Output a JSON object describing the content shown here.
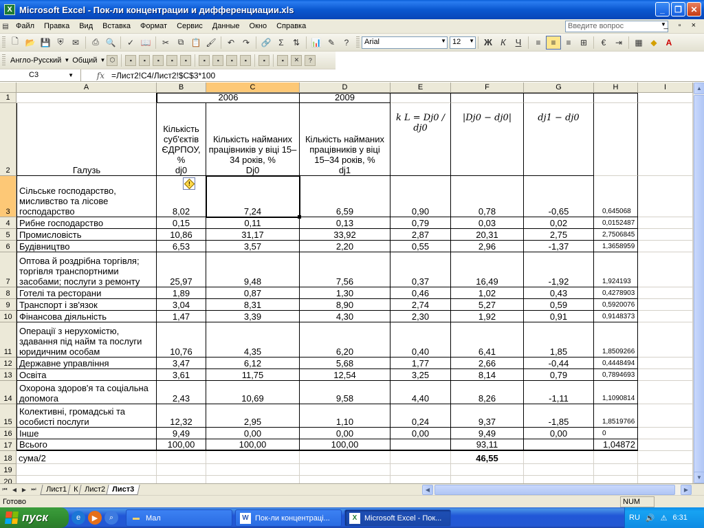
{
  "window": {
    "title": "Microsoft Excel - Пок-ли концентрации и дифференциации.xls",
    "app_icon": "X",
    "controls": [
      "minimize",
      "maximize",
      "close"
    ]
  },
  "menu": {
    "items": [
      "Файл",
      "Правка",
      "Вид",
      "Вставка",
      "Формат",
      "Сервис",
      "Данные",
      "Окно",
      "Справка"
    ],
    "ask_placeholder": "Введите вопрос",
    "mdi_controls": "_ ▫ ×"
  },
  "toolbar": {
    "font_name": "Arial",
    "font_size": "12",
    "bold": "Ж",
    "italic": "К",
    "underline": "Ч",
    "sigma": "Σ",
    "language": "Англо-Русский",
    "general": "Общий"
  },
  "formula_bar": {
    "name_box": "C3",
    "fx": "fx",
    "formula": "=Лист2!C4/Лист2!$C$3*100"
  },
  "columns": [
    "A",
    "B",
    "C",
    "D",
    "E",
    "F",
    "G",
    "H",
    "I"
  ],
  "selected_column": "C",
  "selected_row": "3",
  "header_rows": {
    "year_2006": "2006",
    "year_2009": "2009",
    "a2": "Галузь",
    "b2": "Кількість суб'єктів ЄДРПОУ, %\ndj0",
    "c2": "Кількість найманих працівників у віці 15–34 років, %\nDj0",
    "d2": "Кількість найманих працівників у віці 15–34 років, %\ndj1",
    "e2": "k L = Dj0 / dj0",
    "f2": "|Dj0 − dj0|",
    "g2": "dj1 − dj0"
  },
  "rows": [
    {
      "n": "3",
      "a": "Сільське господарство, мисливство та лісове господарство",
      "b": "8,02",
      "c": "7,24",
      "d": "6,59",
      "e": "0,90",
      "f": "0,78",
      "g": "-0,65",
      "h": "0,645068"
    },
    {
      "n": "4",
      "a": "Рибне господарство",
      "b": "0,15",
      "c": "0,11",
      "d": "0,13",
      "e": "0,79",
      "f": "0,03",
      "g": "0,02",
      "h": "0,0152487"
    },
    {
      "n": "5",
      "a": "Промисловість",
      "b": "10,86",
      "c": "31,17",
      "d": "33,92",
      "e": "2,87",
      "f": "20,31",
      "g": "2,75",
      "h": "2,7506845"
    },
    {
      "n": "6",
      "a": "Будівництво",
      "b": "6,53",
      "c": "3,57",
      "d": "2,20",
      "e": "0,55",
      "f": "2,96",
      "g": "-1,37",
      "h": "1,3658959"
    },
    {
      "n": "7",
      "a": "Оптова й роздрібна торгівля; торгівля транспортними засобами; послуги з ремонту",
      "b": "25,97",
      "c": "9,48",
      "d": "7,56",
      "e": "0,37",
      "f": "16,49",
      "g": "-1,92",
      "h": "1,924193"
    },
    {
      "n": "8",
      "a": "Готелі та ресторани",
      "b": "1,89",
      "c": "0,87",
      "d": "1,30",
      "e": "0,46",
      "f": "1,02",
      "g": "0,43",
      "h": "0,4278903"
    },
    {
      "n": "9",
      "a": "Транспорт і зв'язок",
      "b": "3,04",
      "c": "8,31",
      "d": "8,90",
      "e": "2,74",
      "f": "5,27",
      "g": "0,59",
      "h": "0,5920076"
    },
    {
      "n": "10",
      "a": "Фінансова діяльність",
      "b": "1,47",
      "c": "3,39",
      "d": "4,30",
      "e": "2,30",
      "f": "1,92",
      "g": "0,91",
      "h": "0,9148373"
    },
    {
      "n": "11",
      "a": "Операції з нерухомістю, здавання під найм та послуги юридичним особам",
      "b": "10,76",
      "c": "4,35",
      "d": "6,20",
      "e": "0,40",
      "f": "6,41",
      "g": "1,85",
      "h": "1,8509266"
    },
    {
      "n": "12",
      "a": "Державне управління",
      "b": "3,47",
      "c": "6,12",
      "d": "5,68",
      "e": "1,77",
      "f": "2,66",
      "g": "-0,44",
      "h": "0,4448494"
    },
    {
      "n": "13",
      "a": "Освіта",
      "b": "3,61",
      "c": "11,75",
      "d": "12,54",
      "e": "3,25",
      "f": "8,14",
      "g": "0,79",
      "h": "0,7894693"
    },
    {
      "n": "14",
      "a": "Охорона здоров'я та соціальна допомога",
      "b": "2,43",
      "c": "10,69",
      "d": "9,58",
      "e": "4,40",
      "f": "8,26",
      "g": "-1,11",
      "h": "1,1090814"
    },
    {
      "n": "15",
      "a": "Колективні, громадські та особисті послуги",
      "b": "12,32",
      "c": "2,95",
      "d": "1,10",
      "e": "0,24",
      "f": "9,37",
      "g": "-1,85",
      "h": "1,8519766"
    },
    {
      "n": "16",
      "a": "Інше",
      "b": "9,49",
      "c": "0,00",
      "d": "0,00",
      "e": "0,00",
      "f": "9,49",
      "g": "0,00",
      "h": "0"
    },
    {
      "n": "17",
      "a": "Всього",
      "b": "100,00",
      "c": "100,00",
      "d": "100,00",
      "e": "",
      "f": "93,11",
      "g": "",
      "h": "1,04872"
    },
    {
      "n": "18",
      "a": "сума/2",
      "b": "",
      "c": "",
      "d": "",
      "e": "",
      "f": "46,55",
      "g": "",
      "h": ""
    },
    {
      "n": "19",
      "a": "",
      "b": "",
      "c": "",
      "d": "",
      "e": "",
      "f": "",
      "g": "",
      "h": ""
    },
    {
      "n": "20",
      "a": "",
      "b": "",
      "c": "",
      "d": "",
      "e": "",
      "f": "",
      "g": "",
      "h": ""
    }
  ],
  "sheet_tabs": [
    "Лист1",
    "К",
    "Лист2",
    "Лист3"
  ],
  "active_tab": "Лист3",
  "status": {
    "ready": "Готово",
    "num": "NUM"
  },
  "taskbar": {
    "start": "пуск",
    "tasks": [
      {
        "label": "Мал",
        "icon": "folder-icon"
      },
      {
        "label": "Пок-ли концентраці...",
        "icon": "word-icon"
      },
      {
        "label": "Microsoft Excel - Пок...",
        "icon": "excel-icon"
      }
    ],
    "lang": "RU",
    "clock": "6:31"
  },
  "colors": {
    "selection_header": "#fdc876",
    "title_bar": "#0a58d0",
    "taskbar": "#2358d3",
    "start_button": "#2f8a2f",
    "error_triangle": "#128e2a"
  }
}
